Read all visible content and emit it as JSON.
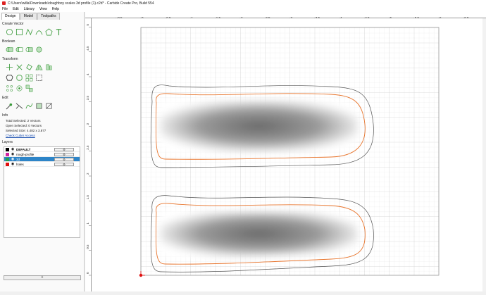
{
  "window": {
    "title": "C:\\Users\\willa\\Downloads\\doughboy scales 3d profile (1).c2d* - Carbide Create Pro, Build 554"
  },
  "menu": [
    "File",
    "Edit",
    "Library",
    "View",
    "Help"
  ],
  "tabs": [
    "Design",
    "Model",
    "Toolpaths"
  ],
  "sections": {
    "create_vector": "Create Vector",
    "boolean": "Boolean",
    "transform": "Transform",
    "edit": "Edit",
    "info": "Info",
    "layers": "Layers"
  },
  "info": {
    "total_selected": "Total Selected:  2 Vectors",
    "open_selected": "Open Selected:  0 Vectors",
    "selected_size": "Selected Size:    4.482 x 3.877",
    "check_cutter": "Check Cutter Access"
  },
  "layers": [
    {
      "name": "DEFAULT",
      "color": "#000000",
      "selected": false
    },
    {
      "name": "rough-profile",
      "color": "#d020a0",
      "selected": false
    },
    {
      "name": "3d",
      "color": "#20a050",
      "selected": true
    },
    {
      "name": "holes",
      "color": "#e01010",
      "selected": false
    }
  ],
  "add_layer_label": "+",
  "ruler_top": [
    "-0.5",
    "0",
    "0.5",
    "1",
    "1.5",
    "2",
    "2.5",
    "3",
    "3.5",
    "4",
    "4.5",
    "5",
    "5.5",
    "6",
    "6.5"
  ],
  "ruler_left": [
    "5",
    "4.5",
    "4",
    "3.5",
    "3",
    "2.5",
    "2",
    "1.5",
    "1",
    "0.5",
    "0"
  ],
  "colors": {
    "accent": "#2e85c8",
    "vector_green": "#3a9a3a",
    "toolpath_orange": "#e8732a",
    "outline_gray": "#555555"
  }
}
